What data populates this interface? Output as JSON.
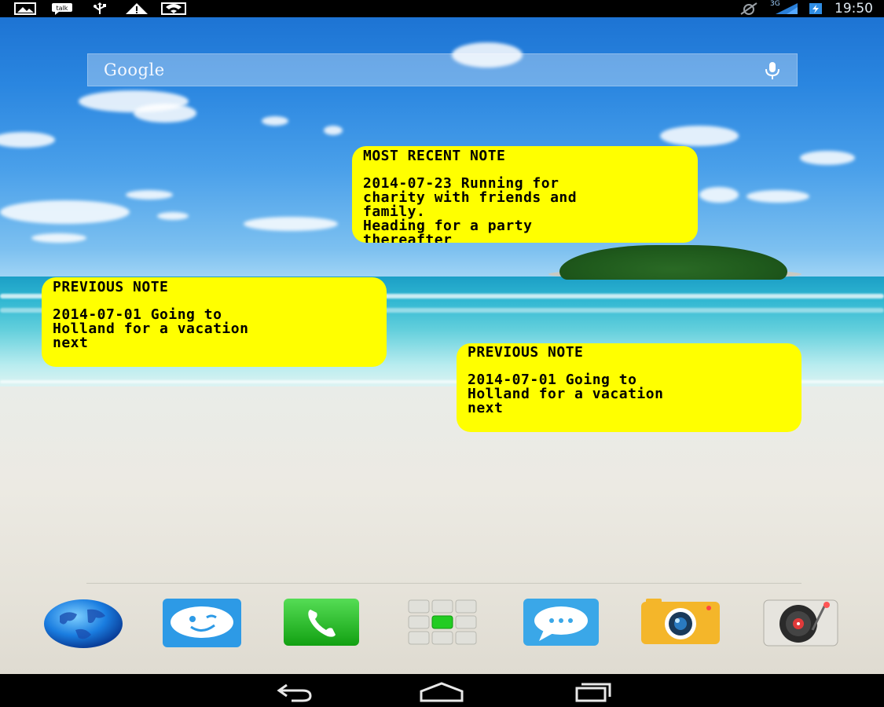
{
  "status_bar": {
    "time": "19:50",
    "network_label": "3G",
    "notification_icons": [
      "picture-icon",
      "talk-icon",
      "usb-icon",
      "warning-icon",
      "wifi-icon"
    ],
    "status_icons": [
      "no-alarm-icon",
      "signal-icon",
      "battery-charging-icon"
    ]
  },
  "search_widget": {
    "logo_text": "Google",
    "mic_icon": "microphone-icon"
  },
  "notes": [
    {
      "title": "MOST RECENT NOTE",
      "body": "2014-07-23 Running for\ncharity with friends and\nfamily.\nHeading for a party\nthereafter"
    },
    {
      "title": "PREVIOUS NOTE",
      "body": "2014-07-01 Going to\nHolland for a vacation\nnext"
    },
    {
      "title": "PREVIOUS NOTE",
      "body": "2014-07-01 Going to\nHolland for a vacation\nnext"
    }
  ],
  "dock": [
    {
      "icon": "globe-browser-icon"
    },
    {
      "icon": "chat-app-icon"
    },
    {
      "icon": "phone-icon"
    },
    {
      "icon": "app-drawer-icon"
    },
    {
      "icon": "messaging-icon"
    },
    {
      "icon": "camera-icon"
    },
    {
      "icon": "music-player-icon"
    }
  ],
  "nav_bar": {
    "buttons": [
      "back-icon",
      "home-icon",
      "recent-apps-icon"
    ]
  },
  "colors": {
    "note_background": "#ffff00",
    "status_bar": "#000000",
    "nav_bar": "#000000"
  }
}
